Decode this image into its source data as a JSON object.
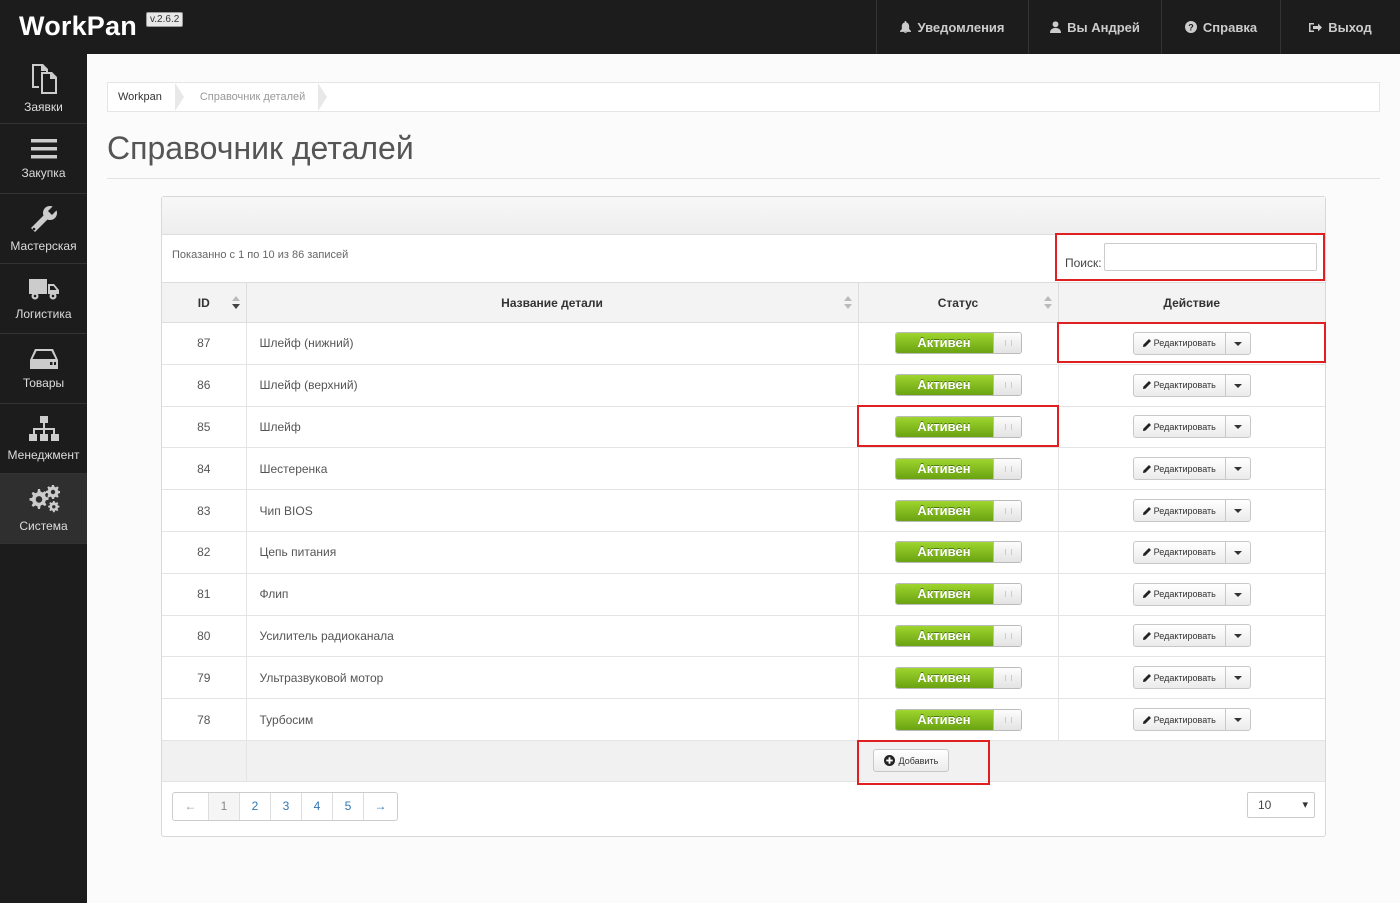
{
  "app": {
    "name": "WorkPan",
    "version": "v.2.6.2"
  },
  "topnav": [
    {
      "label": "Уведомления",
      "icon": "bell-icon"
    },
    {
      "label": "Вы Андрей",
      "icon": "user-icon"
    },
    {
      "label": "Справка",
      "icon": "question-icon"
    },
    {
      "label": "Выход",
      "icon": "logout-icon"
    }
  ],
  "sidebar": [
    {
      "label": "Заявки",
      "icon": "documents-icon"
    },
    {
      "label": "Закупка",
      "icon": "menu-icon"
    },
    {
      "label": "Мастерская",
      "icon": "wrench-icon"
    },
    {
      "label": "Логистика",
      "icon": "truck-icon"
    },
    {
      "label": "Товары",
      "icon": "drive-icon"
    },
    {
      "label": "Менеджмент",
      "icon": "sitemap-icon"
    },
    {
      "label": "Система",
      "icon": "gears-icon"
    }
  ],
  "breadcrumb": [
    "Workpan",
    "Справочник деталей"
  ],
  "page_title": "Справочник деталей",
  "table_info": "Показанно с 1 по 10 из 86 записей",
  "search": {
    "label": "Поиск:",
    "value": ""
  },
  "columns": {
    "id": "ID",
    "name": "Название детали",
    "status": "Статус",
    "action": "Действие"
  },
  "rows": [
    {
      "id": "87",
      "name": "Шлейф (нижний)",
      "status": "Активен"
    },
    {
      "id": "86",
      "name": "Шлейф (верхний)",
      "status": "Активен"
    },
    {
      "id": "85",
      "name": "Шлейф",
      "status": "Активен"
    },
    {
      "id": "84",
      "name": "Шестеренка",
      "status": "Активен"
    },
    {
      "id": "83",
      "name": "Чип BIOS",
      "status": "Активен"
    },
    {
      "id": "82",
      "name": "Цепь питания",
      "status": "Активен"
    },
    {
      "id": "81",
      "name": "Флип",
      "status": "Активен"
    },
    {
      "id": "80",
      "name": "Усилитель радиоканала",
      "status": "Активен"
    },
    {
      "id": "79",
      "name": "Ультразвуковой мотор",
      "status": "Активен"
    },
    {
      "id": "78",
      "name": "Турбосим",
      "status": "Активен"
    }
  ],
  "edit_label": "Редактировать",
  "add_label": "Добавить",
  "pagination": {
    "prev": "←",
    "pages": [
      "1",
      "2",
      "3",
      "4",
      "5"
    ],
    "next": "→",
    "current": "1"
  },
  "per_page": "10",
  "colors": {
    "topbar": "#1c1c1c",
    "toggle_green": "#7ab51d",
    "highlight": "#e02020"
  }
}
